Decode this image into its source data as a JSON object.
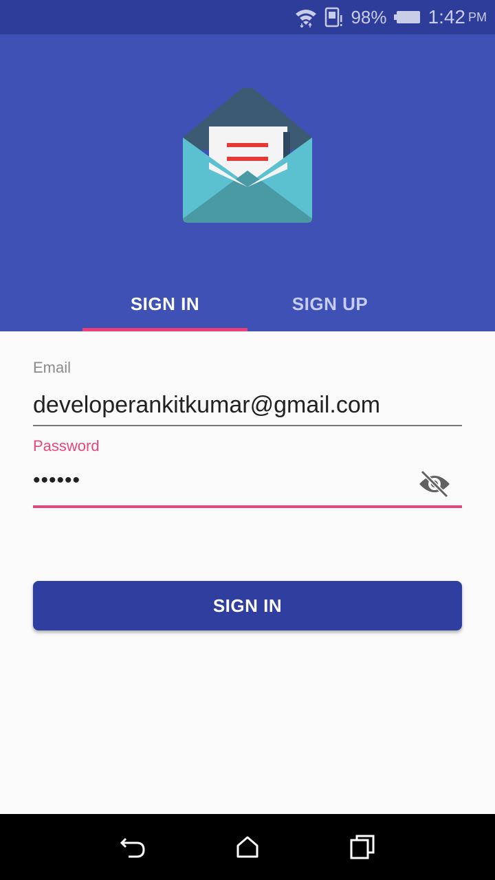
{
  "status_bar": {
    "battery": "98%",
    "time": "1:42",
    "ampm": "PM",
    "icons": [
      "wifi-icon",
      "sim-alert-icon",
      "battery-icon"
    ]
  },
  "header": {
    "logo": "envelope-icon",
    "tabs": [
      {
        "label": "SIGN IN",
        "active": true
      },
      {
        "label": "SIGN UP",
        "active": false
      }
    ]
  },
  "form": {
    "email_label": "Email",
    "email_value": "developerankitkumar@gmail.com",
    "password_label": "Password",
    "password_value": "••••••",
    "visibility_icon": "eye-off-icon",
    "submit_label": "SIGN IN"
  },
  "nav_bar": {
    "icons": [
      "back-icon",
      "home-icon",
      "recents-icon"
    ]
  },
  "colors": {
    "primary": "#3f51b5",
    "primary_dark": "#303f9f",
    "accent": "#ec407a"
  }
}
